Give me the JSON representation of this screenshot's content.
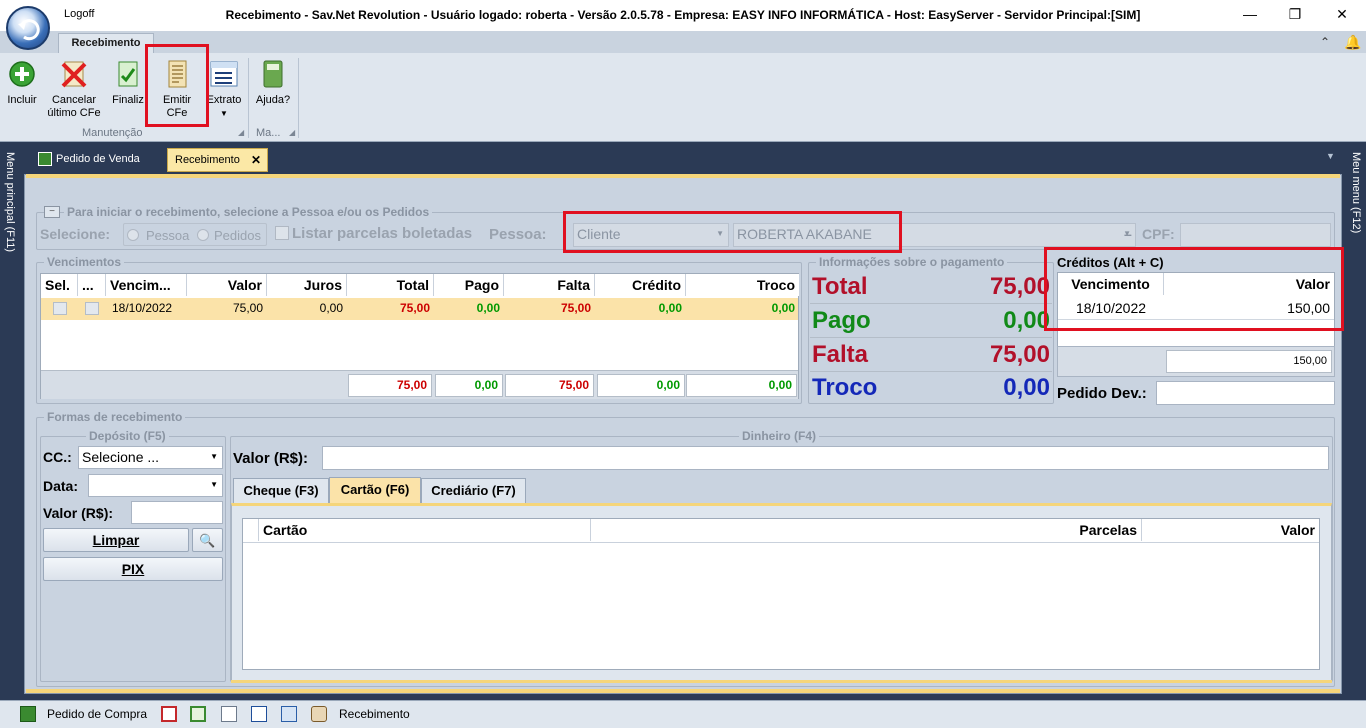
{
  "window": {
    "logoff": "Logoff",
    "title": "Recebimento - Sav.Net Revolution - Usuário logado: roberta - Versão 2.0.5.78 - Empresa: EASY INFO INFORMÁTICA - Host: EasyServer - Servidor Principal:[SIM]"
  },
  "ribbon": {
    "tab": "Recebimento",
    "buttons": {
      "incluir": "Incluir",
      "cancelar_1": "Cancelar",
      "cancelar_2": "último CFe",
      "finalizar": "Finaliz",
      "emitir_1": "Emitir",
      "emitir_2": "CFe",
      "extrato": "Extrato",
      "ajuda": "Ajuda?"
    },
    "group_manutencao": "Manutenção",
    "group_ma": "Ma..."
  },
  "doctabs": {
    "pedido_venda": "Pedido de Venda",
    "recebimento": "Recebimento"
  },
  "rails": {
    "left": "Menu principal (F11)",
    "right": "Meu menu (F12)"
  },
  "inicio": {
    "legend": "Para iniciar o recebimento, selecione a Pessoa e/ou os Pedidos",
    "selecione": "Selecione:",
    "pessoa_radio": "Pessoa",
    "pedidos_radio": "Pedidos",
    "listar": "Listar parcelas boletadas",
    "pessoa_label": "Pessoa:",
    "tipo": "Cliente",
    "nome": "ROBERTA AKABANE",
    "cpf_label": "CPF:"
  },
  "vencimentos": {
    "legend": "Vencimentos",
    "headers": [
      "Sel.",
      "...",
      "Vencim...",
      "Valor",
      "Juros",
      "Total",
      "Pago",
      "Falta",
      "Crédito",
      "Troco"
    ],
    "row": {
      "venc": "18/10/2022",
      "valor": "75,00",
      "juros": "0,00",
      "total": "75,00",
      "pago": "0,00",
      "falta": "75,00",
      "credito": "0,00",
      "troco": "0,00"
    },
    "totals": {
      "total": "75,00",
      "pago": "0,00",
      "falta": "75,00",
      "credito": "0,00",
      "troco": "0,00"
    }
  },
  "info": {
    "legend": "Informações sobre o pagamento",
    "total_label": "Total",
    "total": "75,00",
    "pago_label": "Pago",
    "pago": "0,00",
    "falta_label": "Falta",
    "falta": "75,00",
    "troco_label": "Troco",
    "troco": "0,00"
  },
  "creditos": {
    "title": "Créditos (Alt + C)",
    "headers": [
      "Vencimento",
      "Valor"
    ],
    "row": {
      "venc": "18/10/2022",
      "valor": "150,00"
    },
    "total": "150,00",
    "pedido_dev": "Pedido Dev.:"
  },
  "formas": {
    "legend": "Formas de recebimento",
    "deposito": "Depósito (F5)",
    "cc_label": "CC.:",
    "cc_value": "Selecione ...",
    "data_label": "Data:",
    "valor_label": "Valor (R$):",
    "limpar": "Limpar",
    "pix": "PIX",
    "dinheiro": "Dinheiro (F4)",
    "din_valor_label": "Valor (R$):",
    "tabs": [
      "Cheque (F3)",
      "Cartão (F6)",
      "Crediário (F7)"
    ],
    "cartao_headers": [
      "Cartão",
      "Parcelas",
      "Valor"
    ]
  },
  "statusbar": {
    "pedido_compra": "Pedido de Compra",
    "recebimento": "Recebimento"
  }
}
